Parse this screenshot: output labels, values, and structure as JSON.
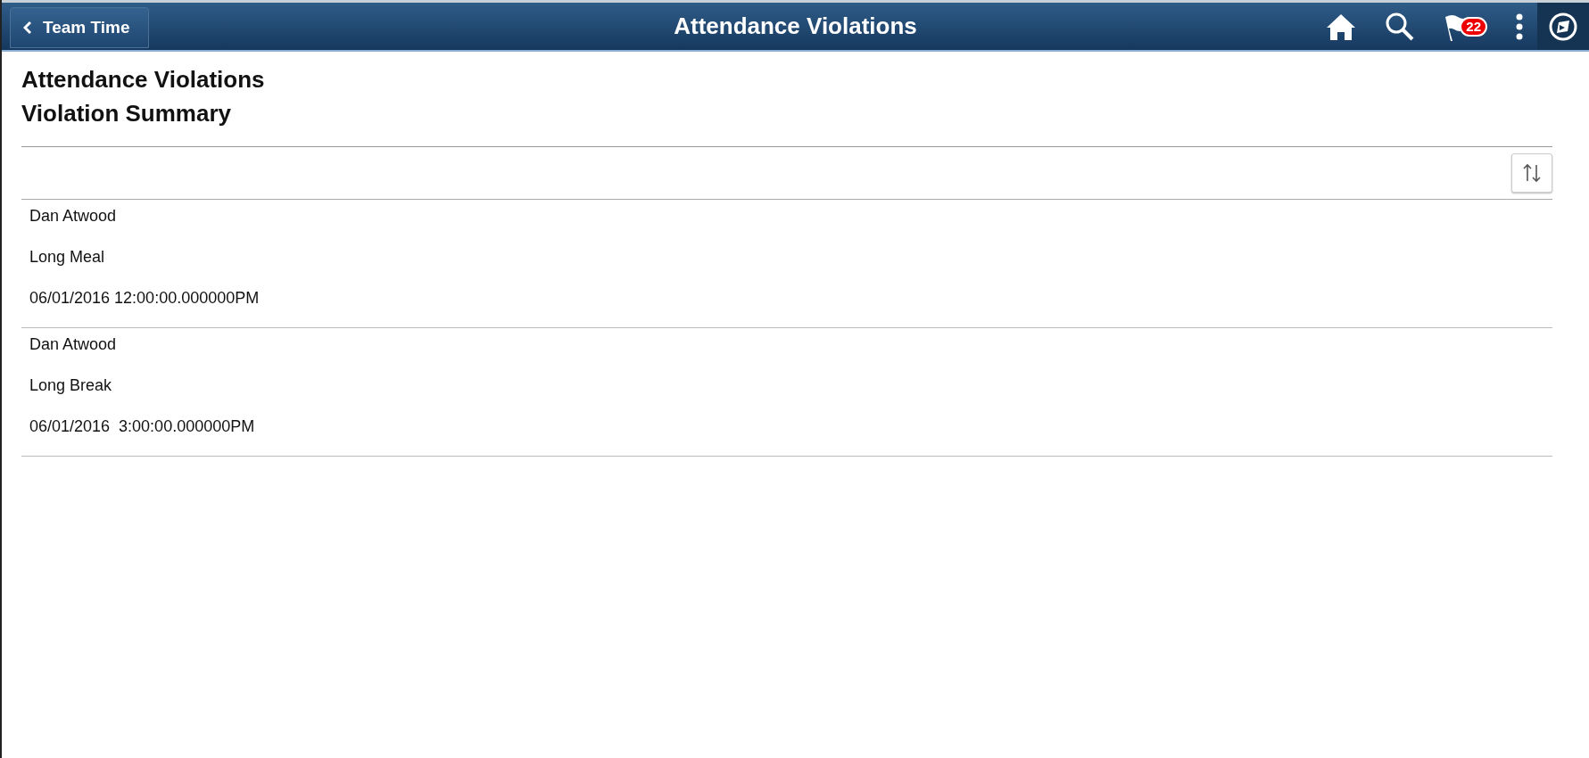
{
  "header": {
    "back_label": "Team Time",
    "title": "Attendance Violations",
    "notification_count": "22"
  },
  "page": {
    "title": "Attendance Violations",
    "subtitle": "Violation Summary"
  },
  "violations": [
    {
      "name": "Dan Atwood",
      "type": "Long Meal",
      "datetime": "06/01/2016 12:00:00.000000PM"
    },
    {
      "name": "Dan Atwood",
      "type": "Long Break",
      "datetime": "06/01/2016  3:00:00.000000PM"
    }
  ]
}
